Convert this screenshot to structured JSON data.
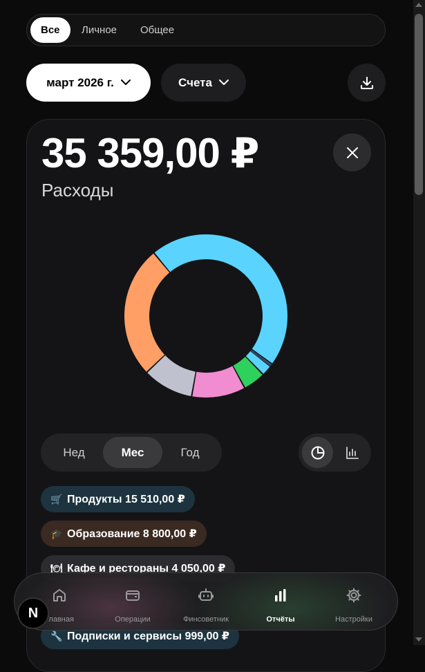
{
  "filter_tabs": [
    {
      "label": "Все",
      "active": true
    },
    {
      "label": "Личное",
      "active": false
    },
    {
      "label": "Общее",
      "active": false
    }
  ],
  "period_button": {
    "label": "март 2026 г.",
    "icon": "chevron-down-icon"
  },
  "accounts_button": {
    "label": "Счета",
    "icon": "chevron-down-icon"
  },
  "download_button": {
    "icon": "download-icon"
  },
  "summary": {
    "amount": "35 359,00 ₽",
    "label": "Расходы"
  },
  "close_button": {
    "icon": "close-icon"
  },
  "chart_data": {
    "type": "pie",
    "style": "donut",
    "slices": [
      {
        "name": "Продукты",
        "value": 15510,
        "color": "#5ad4ff"
      },
      {
        "name": "",
        "value": 120,
        "color": "#5ad4ff"
      },
      {
        "name": "",
        "value": 60,
        "color": "#7a7cff"
      },
      {
        "name": "",
        "value": 720,
        "color": "#5ad4ff"
      },
      {
        "name": "",
        "value": 1500,
        "color": "#2fd15d"
      },
      {
        "name": "",
        "value": 3600,
        "color": "#f08ccf"
      },
      {
        "name": "",
        "value": 3400,
        "color": "#c0c1cf"
      },
      {
        "name": "Образование",
        "value": 8800,
        "color": "#ff9f66"
      }
    ]
  },
  "period_switch": [
    {
      "label": "Нед",
      "active": false
    },
    {
      "label": "Мес",
      "active": true
    },
    {
      "label": "Год",
      "active": false
    }
  ],
  "chart_type_switch": [
    {
      "icon": "pie-chart-icon",
      "active": true
    },
    {
      "icon": "bar-chart-icon",
      "active": false
    }
  ],
  "categories": [
    {
      "emoji": "🛒",
      "label": "Продукты 15 510,00 ₽",
      "bg": "#1d3440"
    },
    {
      "emoji": "🎓",
      "label": "Образование 8 800,00 ₽",
      "bg": "#3b2a22"
    },
    {
      "emoji": "🍽",
      "label": "Кафе и рестораны 4 050,00 ₽",
      "bg": "#2c2c30"
    },
    {
      "emoji": "🔧",
      "label": "Подписки и сервисы 999,00 ₽",
      "bg": "#1d3440"
    }
  ],
  "bottom_nav": [
    {
      "label": "Главная",
      "icon": "home-icon",
      "active": false
    },
    {
      "label": "Операции",
      "icon": "wallet-icon",
      "active": false
    },
    {
      "label": "Финсоветник",
      "icon": "robot-icon",
      "active": false
    },
    {
      "label": "Отчёты",
      "icon": "bar-chart-icon",
      "active": true
    },
    {
      "label": "Настройки",
      "icon": "gear-icon",
      "active": false
    }
  ],
  "dev_badge": {
    "label": "N"
  }
}
